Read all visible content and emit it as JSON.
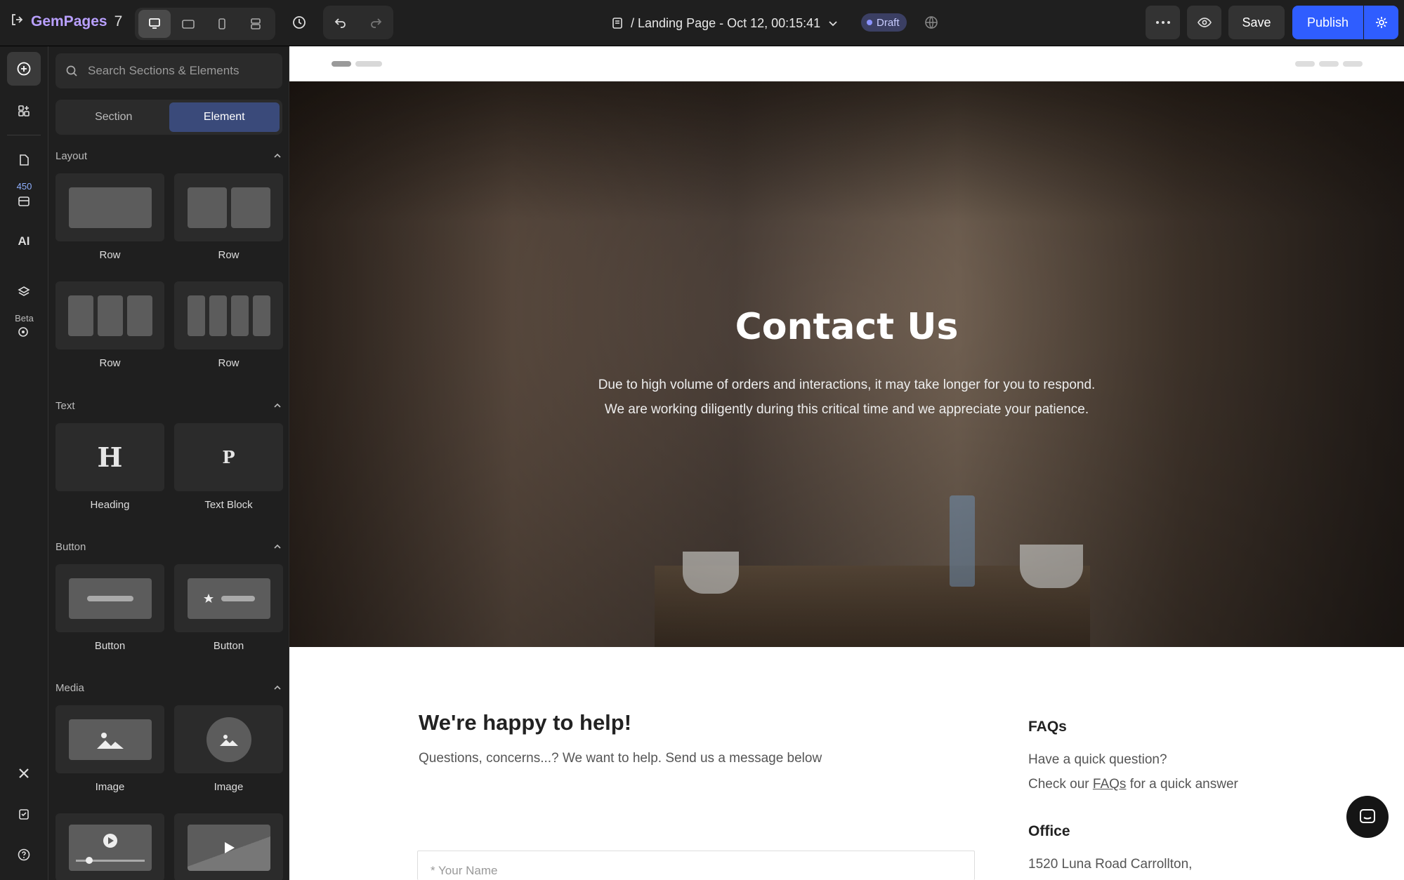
{
  "topbar": {
    "brand": "GemPages",
    "brand_version": "7",
    "page_title": "/ Landing Page - Oct 12, 00:15:41",
    "status_badge": "Draft",
    "save_label": "Save",
    "publish_label": "Publish"
  },
  "rail": {
    "badge_count": "450",
    "ai_label": "AI",
    "beta_label": "Beta"
  },
  "panel": {
    "search_placeholder": "Search Sections & Elements",
    "tabs": {
      "section": "Section",
      "element": "Element",
      "selected": "Element"
    },
    "categories": {
      "layout": "Layout",
      "text": "Text",
      "button": "Button",
      "media": "Media"
    },
    "layout_items": [
      "Row",
      "Row",
      "Row",
      "Row"
    ],
    "text_items": [
      {
        "glyph": "H",
        "label": "Heading"
      },
      {
        "glyph": "P",
        "label": "Text Block"
      }
    ],
    "button_items": [
      "Button",
      "Button"
    ],
    "media_items": [
      "Image",
      "Image"
    ]
  },
  "canvas": {
    "hero": {
      "title": "Contact Us",
      "line1": "Due to high volume of orders and interactions, it may take longer for you to respond.",
      "line2": "We are working diligently during this critical time and we appreciate your patience."
    },
    "form": {
      "title": "We're happy to help!",
      "subtitle": "Questions, concerns...? We want to help. Send us a message below",
      "name_placeholder": "* Your Name"
    },
    "side": {
      "faq_title": "FAQs",
      "faq_line1": "Have a quick question?",
      "faq_prefix": "Check our",
      "faq_link": "FAQs",
      "faq_suffix": "for a quick answer",
      "office_title": "Office",
      "office_address": "1520 Luna Road Carrollton,"
    }
  },
  "colors": {
    "accent": "#2f5dff",
    "brand": "#b9a0ff",
    "panel_bg": "#1f1f1f"
  }
}
